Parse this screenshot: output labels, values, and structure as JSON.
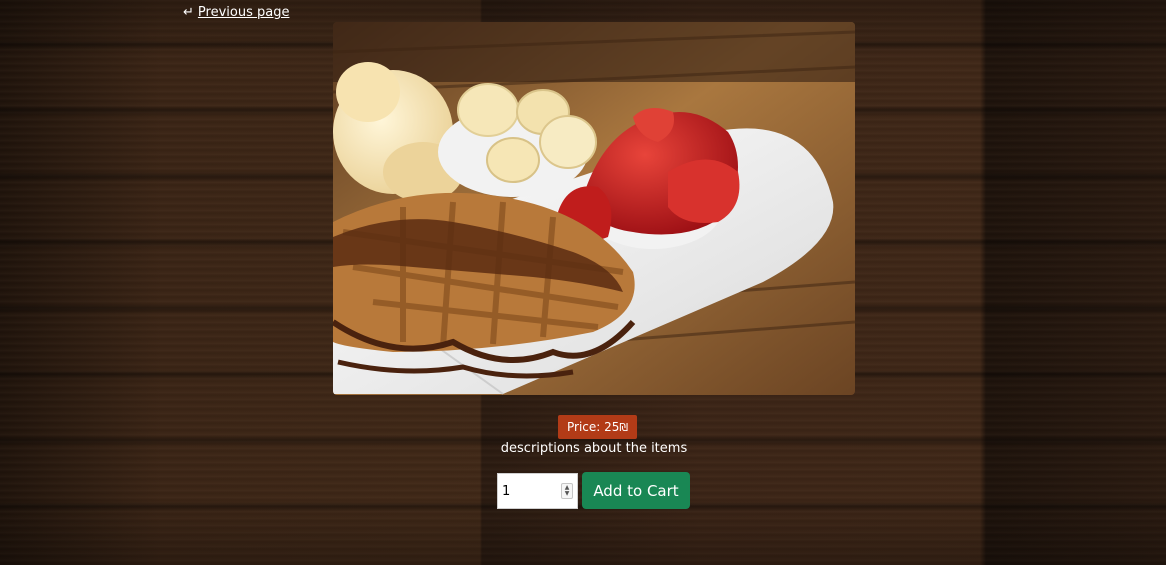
{
  "nav": {
    "back_label": "Previous page",
    "back_icon": "return-arrow-icon"
  },
  "product": {
    "image_subject": "waffles-with-chocolate-bananas-strawberries-ice-cream",
    "price_label": "Price: 25",
    "currency_icon": "shekel-icon",
    "description": "descriptions about the items"
  },
  "cart": {
    "quantity_value": "1",
    "add_button_label": "Add to Cart"
  },
  "colors": {
    "price_badge": "#b23b17",
    "add_button": "#198754"
  }
}
